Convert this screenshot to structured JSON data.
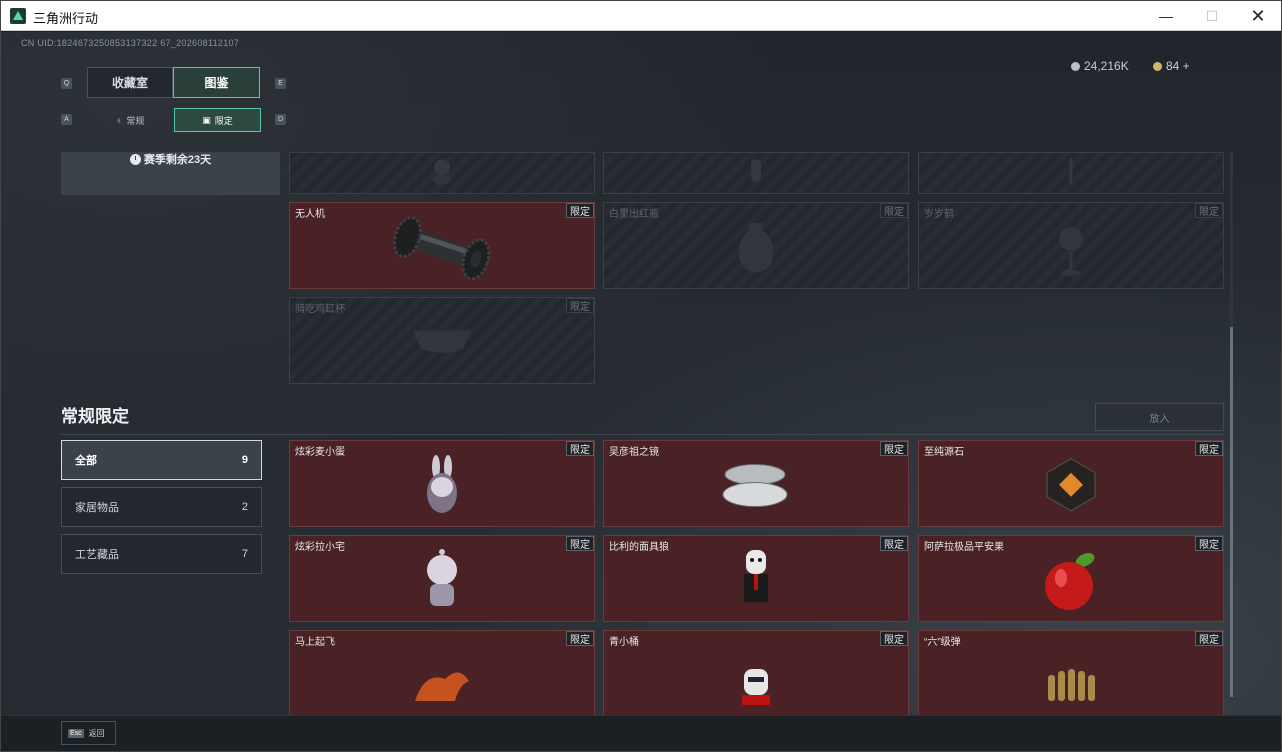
{
  "window": {
    "title": "三角洲行动"
  },
  "header": {
    "uid": "CN UID:1824673250853137322 67_202608112107",
    "currency": [
      {
        "value": "24,216K",
        "icon": "silver-coin-icon",
        "color": "#b8bfc6"
      },
      {
        "value": "84 +",
        "icon": "gold-coin-icon",
        "color": "#d6b36a"
      }
    ]
  },
  "tabs": {
    "main": [
      {
        "label": "收藏室",
        "active": false
      },
      {
        "label": "图鉴",
        "active": true
      }
    ],
    "main_keys": [
      "Q",
      "E"
    ],
    "sub": [
      {
        "label": "常规",
        "icon": "flame-icon",
        "active": false
      },
      {
        "label": "限定",
        "icon": "frame-icon",
        "active": true
      }
    ],
    "sub_keys": [
      "A",
      "D"
    ]
  },
  "season": {
    "label": "赛季剩余23天"
  },
  "limited_items": [
    {
      "name": "",
      "badge": "",
      "owned": false
    },
    {
      "name": "",
      "badge": "",
      "owned": false
    },
    {
      "name": "",
      "badge": "",
      "owned": false
    },
    {
      "name": "无人机",
      "badge": "限定",
      "owned": true
    },
    {
      "name": "白里出红瓶",
      "badge": "限定",
      "owned": false
    },
    {
      "name": "岁岁鹤",
      "badge": "限定",
      "owned": false
    },
    {
      "name": "骑吃鸡缸杯",
      "badge": "限定",
      "owned": false
    }
  ],
  "regular_limited": {
    "title": "常规限定",
    "put_button": "放入",
    "filters": [
      {
        "label": "全部",
        "count": "9",
        "active": true
      },
      {
        "label": "家居物品",
        "count": "2",
        "active": false
      },
      {
        "label": "工艺藏品",
        "count": "7",
        "active": false
      }
    ],
    "items": [
      {
        "name": "炫彩麦小蛋",
        "badge": "限定"
      },
      {
        "name": "吴彦祖之镜",
        "badge": "限定"
      },
      {
        "name": "至纯源石",
        "badge": "限定"
      },
      {
        "name": "炫彩拉小宅",
        "badge": "限定"
      },
      {
        "name": "比利的面具狼",
        "badge": "限定"
      },
      {
        "name": "阿萨拉极品平安果",
        "badge": "限定"
      },
      {
        "name": "马上起飞",
        "badge": "限定"
      },
      {
        "name": "青小桶",
        "badge": "限定"
      },
      {
        "name": "“六”级弹",
        "badge": "限定"
      }
    ]
  },
  "footer": {
    "esc_key": "Esc",
    "back_label": "返回"
  }
}
